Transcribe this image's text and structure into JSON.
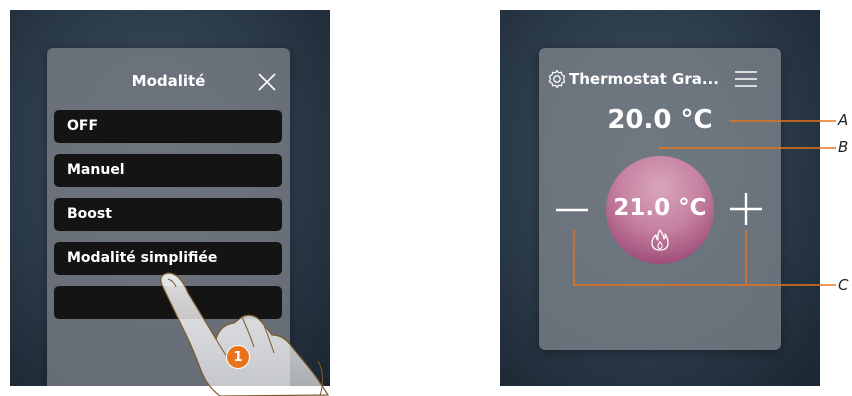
{
  "mode_menu": {
    "title": "Modalité",
    "close_icon": "close-icon",
    "items": [
      {
        "label": "OFF"
      },
      {
        "label": "Manuel"
      },
      {
        "label": "Boost"
      },
      {
        "label": "Modalité simplifiée"
      },
      {
        "label": ""
      }
    ],
    "step_badge": "1",
    "hand_icon": "pointing-hand"
  },
  "thermostat": {
    "name": "Thermostat Gra...",
    "settings_icon": "gear-icon",
    "menu_icon": "hamburger-menu-icon",
    "measured_temp": "20.0 °C",
    "setpoint_temp": "21.0 °C",
    "mode_icon": "flame-icon",
    "decrease_icon": "minus-icon",
    "increase_icon": "plus-icon"
  },
  "callouts": {
    "a": "A",
    "b": "B",
    "c": "C",
    "color": "#e8731d"
  },
  "colors": {
    "background": "#2b3a49",
    "card": "#7d828a",
    "menu_item": "#141414",
    "setpoint_dial": "#c580a0",
    "accent": "#e8731d"
  }
}
